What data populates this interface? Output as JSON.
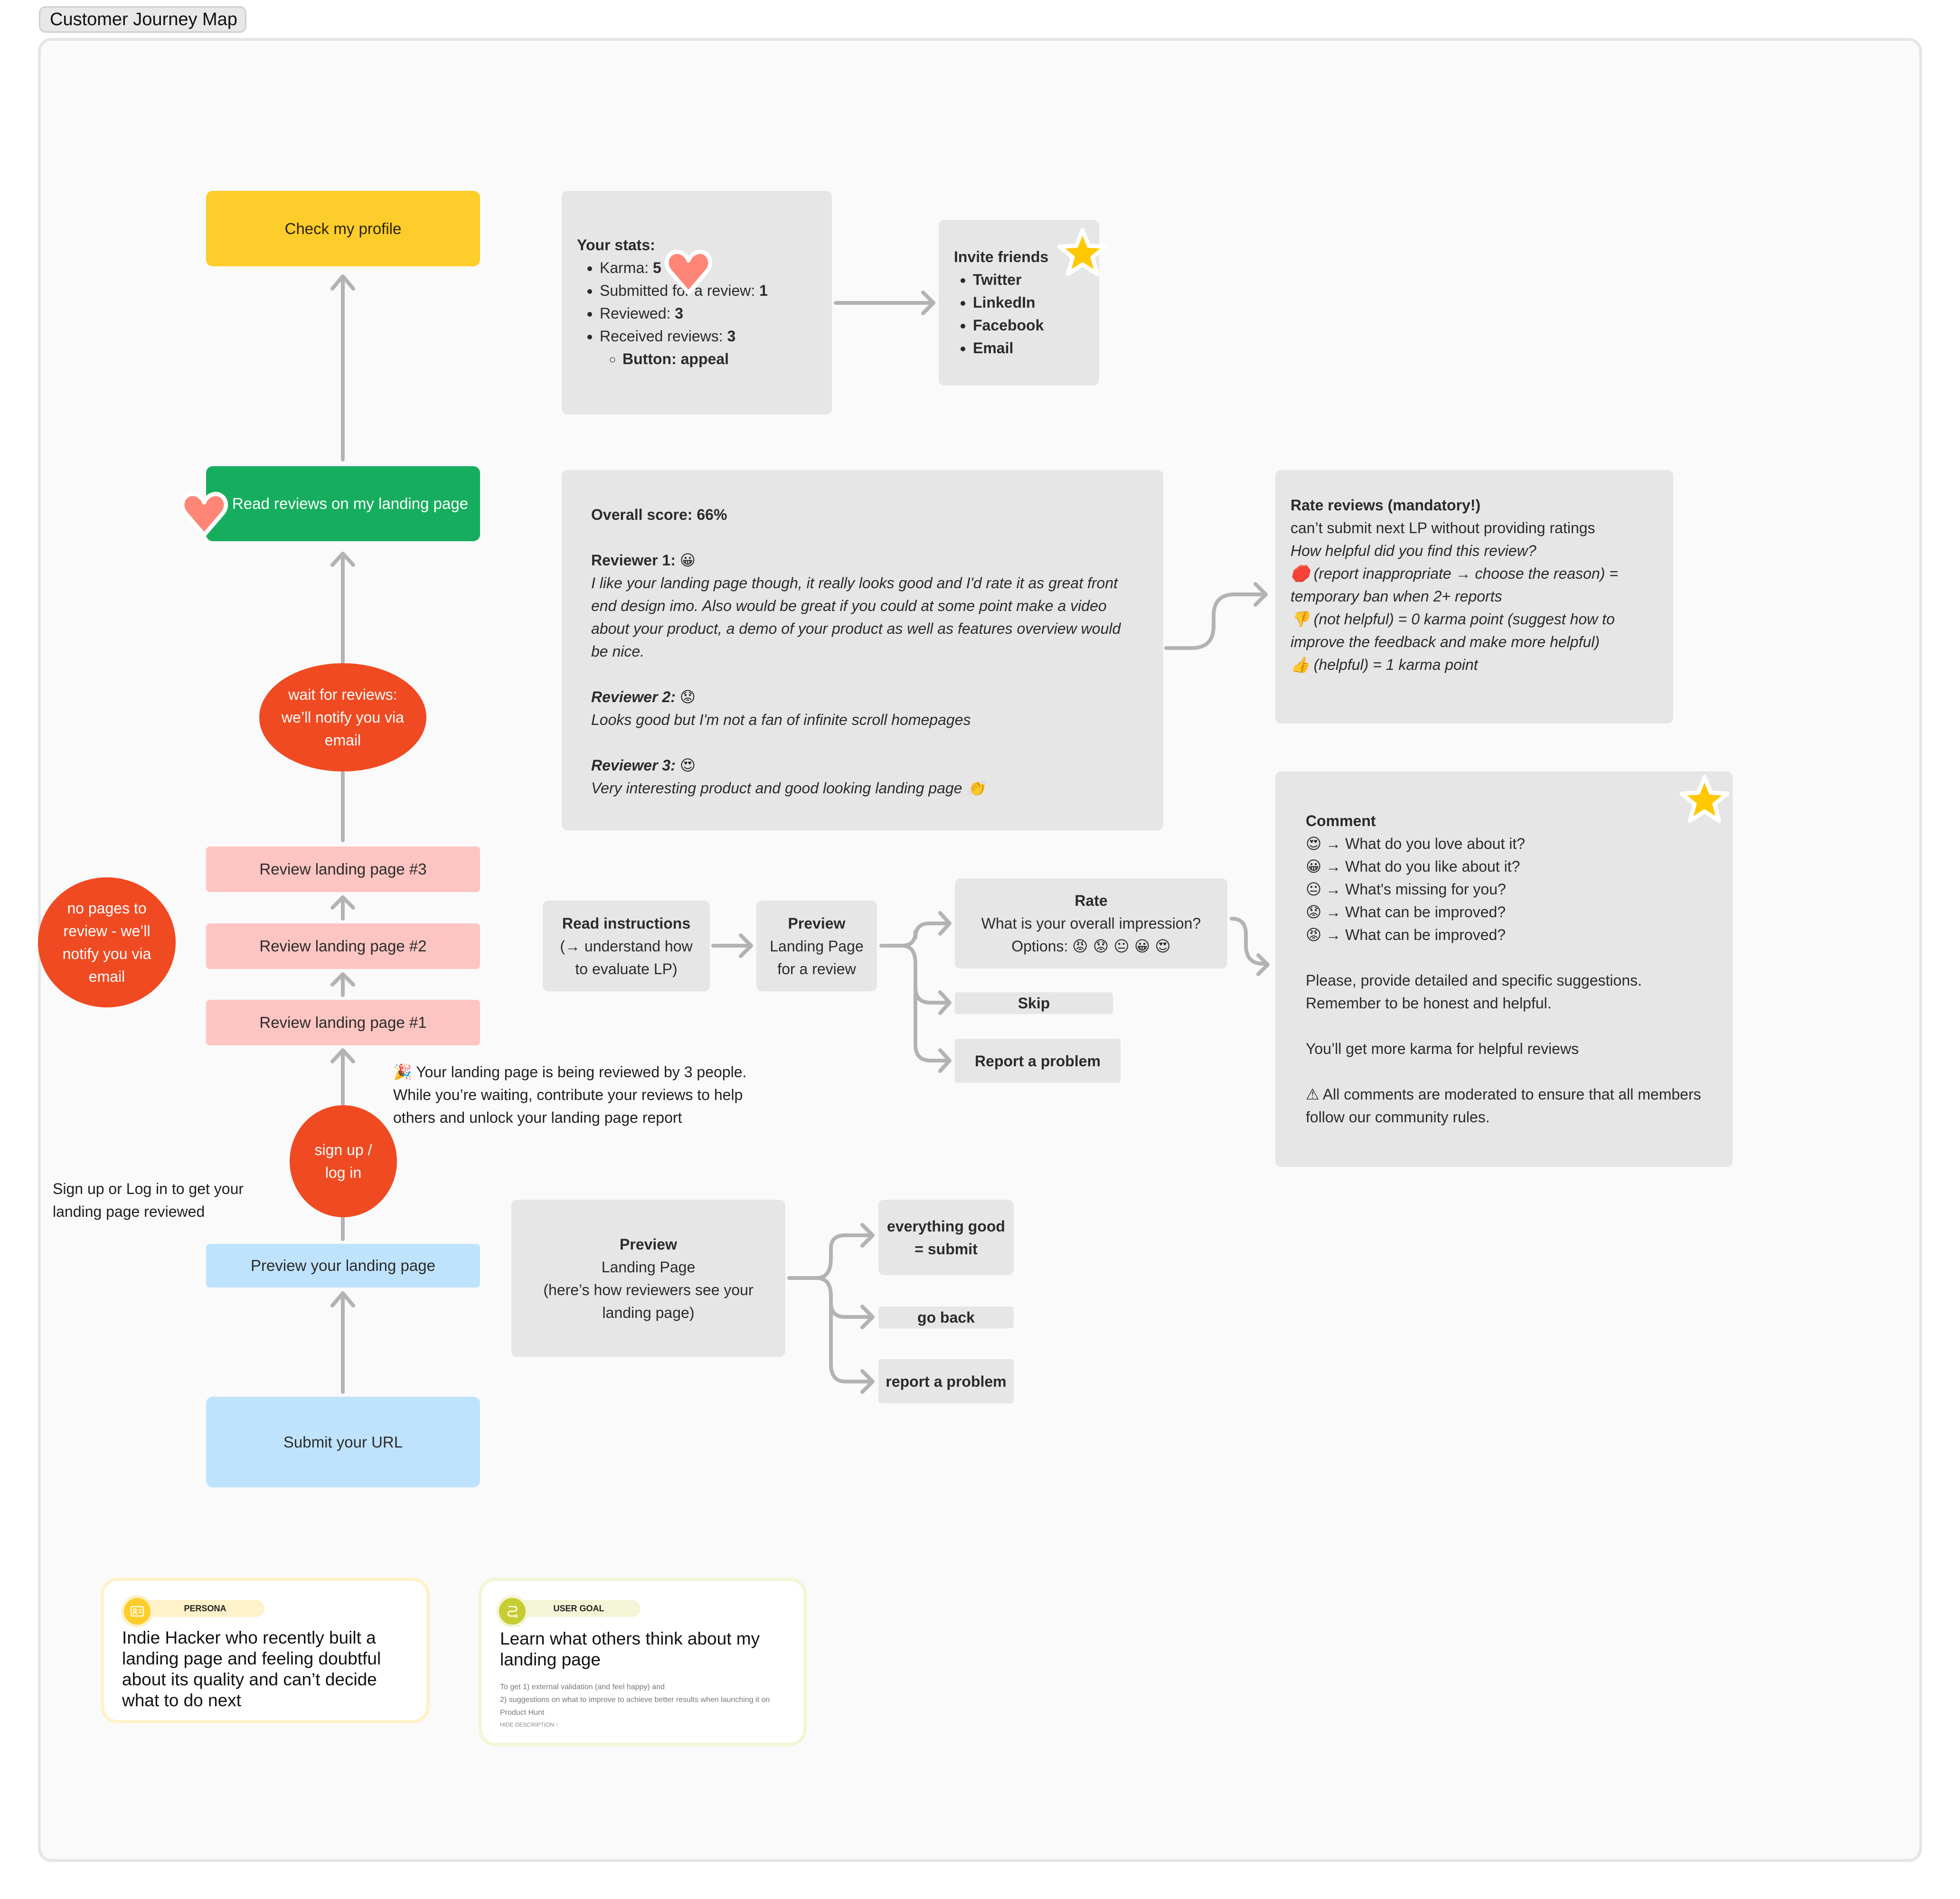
{
  "board": {
    "title": "Customer Journey Map"
  },
  "colors": {
    "yellow": "#fdcd2b",
    "green": "#16ae5e",
    "pink": "#fdc5c1",
    "blue": "#bfe3fd",
    "red": "#f04a22",
    "grey_box": "#e6e6e6",
    "connector": "#b3b3b3",
    "heart": "#ff8576",
    "star": "#ffc800"
  },
  "flow": {
    "check_profile": "Check my profile",
    "read_reviews": "Read reviews on my landing page",
    "wait_for_reviews": "wait for reviews: we’ll notify you via email",
    "review_3": "Review landing page #3",
    "review_2": "Review landing page #2",
    "review_1": "Review landing page #1",
    "no_pages": "no pages to review - we’ll notify you via email",
    "sign_up": "sign up / log in",
    "preview_own": "Preview your landing page",
    "submit_url": "Submit your URL"
  },
  "annotations": {
    "signup_note": "Sign up or Log in to get your landing page reviewed",
    "reviewing_notice_emoji": "🎉",
    "reviewing_notice": "Your landing page is being reviewed by 3 people. While you’re waiting, contribute your reviews to help others and unlock your landing page report"
  },
  "stats": {
    "heading": "Your stats:",
    "items": [
      {
        "label": "Karma: ",
        "value": "5"
      },
      {
        "label": "Submitted for a review: ",
        "value": "1"
      },
      {
        "label": "Reviewed: ",
        "value": "3"
      },
      {
        "label": "Received reviews: ",
        "value": "3"
      }
    ],
    "sub_item": "Button: appeal"
  },
  "invite": {
    "heading": "Invite friends",
    "items": [
      "Twitter",
      "LinkedIn",
      "Facebook",
      "Email"
    ]
  },
  "reviews": {
    "overall": "Overall score: 66%",
    "list": [
      {
        "name": "Reviewer 1:",
        "emoji": "😀",
        "text": "I like your landing page though, it really looks good and I'd rate it as great front end design imo. Also would be great if you could at some point make a video about your product, a demo of your product as well as features overview would be nice."
      },
      {
        "name": "Reviewer 2:",
        "emoji": "😟",
        "text": "Looks good but I'm not a fan of infinite scroll homepages"
      },
      {
        "name": "Reviewer 3:",
        "emoji": "😍",
        "text": "Very interesting product and good looking landing page 👏"
      }
    ]
  },
  "rate_reviews": {
    "heading": "Rate reviews (mandatory!)",
    "line1": "can’t submit next LP without providing ratings",
    "question": "How helpful did you find this review?",
    "report_emoji": "🛑",
    "report_text": "(report inappropriate → choose the reason) = temporary ban when 2+ reports",
    "down_emoji": "👎",
    "down_text": "(not helpful) = 0 karma point (suggest how to improve the feedback and make more helpful)",
    "up_emoji": "👍",
    "up_text": "(helpful) = 1 karma point"
  },
  "comment": {
    "heading": "Comment",
    "prompts": [
      {
        "emoji": "😍",
        "text": "→ What do you love about it?"
      },
      {
        "emoji": "😀",
        "text": "→ What do you like about it?"
      },
      {
        "emoji": "😐",
        "text": "→ What's missing for you?"
      },
      {
        "emoji": "😟",
        "text": "→ What can be improved?"
      },
      {
        "emoji": "😡",
        "text": "→ What can be improved?"
      }
    ],
    "para1": "Please, provide detailed and specific suggestions. Remember to be honest and helpful.",
    "para2": "You’ll get more karma for helpful reviews",
    "warning_icon": "⚠",
    "para3": "All comments are moderated to ensure that all members follow our community rules."
  },
  "review_flow": {
    "read_instructions_title": "Read instructions",
    "read_instructions_body": "(→ understand how to evaluate LP)",
    "preview_title": "Preview",
    "preview_body": "Landing Page for a review",
    "rate_title": "Rate",
    "rate_question": "What is your overall impression?",
    "rate_options_label": "Options:",
    "rate_options": "😡 😟 😐 😀 😍",
    "skip": "Skip",
    "report": "Report a problem"
  },
  "preview_flow": {
    "title": "Preview",
    "body1": "Landing Page",
    "body2": "(here’s how reviewers see your landing page)",
    "submit": "everything good = submit",
    "go_back": "go back",
    "report": "report a problem"
  },
  "persona": {
    "badge": "PERSONA",
    "text": "Indie Hacker who recently built a landing page and feeling doubtful about its quality and can’t decide what to do next"
  },
  "user_goal": {
    "badge": "USER GOAL",
    "title": "Learn what others think about my landing page",
    "desc1": "To get 1) external validation (and feel happy) and",
    "desc2": "2) suggestions on what to improve to achieve better results when launching it on Product Hunt",
    "toggle": "HIDE DESCRIPTION ↑"
  }
}
